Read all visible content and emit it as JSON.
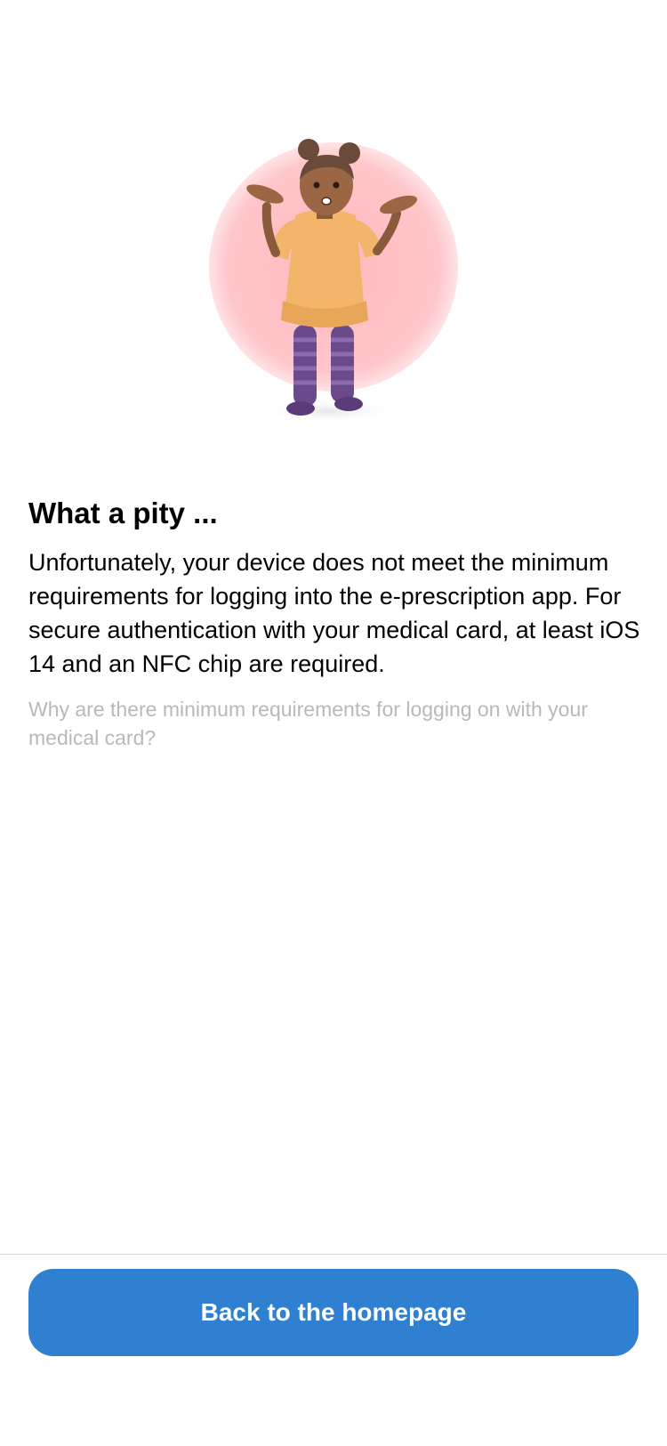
{
  "illustration": {
    "icon": "shrugging-girl-illustration",
    "circle_color": "#ffc2c6",
    "dress_color": "#f2b56a",
    "stockings_color": "#6b4a8c"
  },
  "message": {
    "title": "What a pity ...",
    "description": "Unfortunately, your device does not meet the minimum requirements for logging into the e-prescription app. For secure authentication with your medical card, at least iOS 14 and an NFC chip are required.",
    "help_link": "Why are there minimum requirements for logging on with your medical card?"
  },
  "footer": {
    "button_label": "Back to the homepage",
    "button_color": "#2f80d0"
  }
}
